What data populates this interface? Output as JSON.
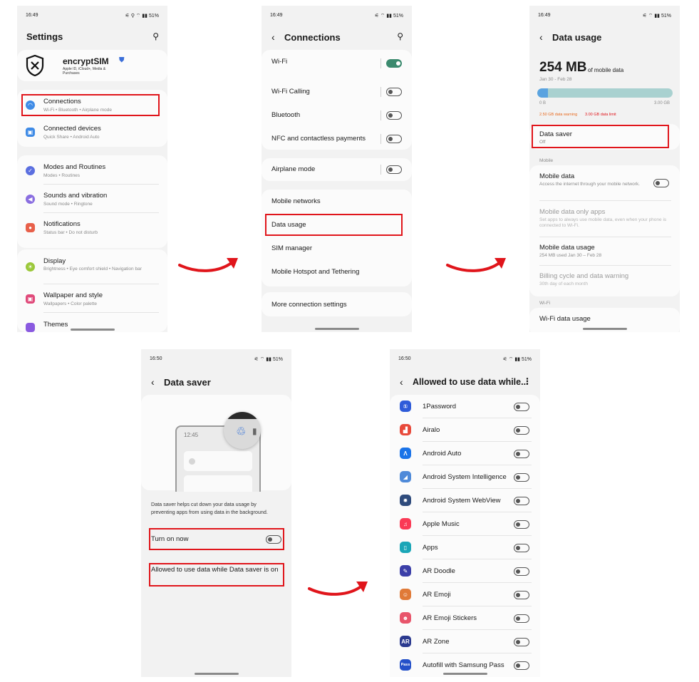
{
  "status": {
    "time_1": "16:49",
    "time_2": "16:49",
    "time_3": "16:49",
    "time_4": "16:50",
    "time_5": "16:50",
    "icons": "51%"
  },
  "settings": {
    "title": "Settings",
    "account_name": "encryptSIM",
    "account_sub": "Apple ID, iCloud+, Media & Purchases",
    "items": [
      {
        "label": "Connections",
        "sub": "Wi-Fi • Bluetooth • Airplane mode"
      },
      {
        "label": "Connected devices",
        "sub": "Quick Share • Android Auto"
      },
      {
        "label": "Modes and Routines",
        "sub": "Modes • Routines"
      },
      {
        "label": "Sounds and vibration",
        "sub": "Sound mode • Ringtone"
      },
      {
        "label": "Notifications",
        "sub": "Status bar • Do not disturb"
      },
      {
        "label": "Display",
        "sub": "Brightness • Eye comfort shield • Navigation bar"
      },
      {
        "label": "Wallpaper and style",
        "sub": "Wallpapers • Color palette"
      },
      {
        "label": "Themes",
        "sub": ""
      }
    ]
  },
  "connections": {
    "title": "Connections",
    "items": [
      {
        "label": "Wi-Fi"
      },
      {
        "label": "Wi-Fi Calling"
      },
      {
        "label": "Bluetooth"
      },
      {
        "label": "NFC and contactless payments"
      },
      {
        "label": "Airplane mode"
      },
      {
        "label": "Mobile networks"
      },
      {
        "label": "Data usage"
      },
      {
        "label": "SIM manager"
      },
      {
        "label": "Mobile Hotspot and Tethering"
      },
      {
        "label": "More connection settings"
      }
    ]
  },
  "data_usage": {
    "title": "Data usage",
    "amount": "254 MB",
    "amount_suffix": "of mobile data",
    "period": "Jan 30 - Feb 28",
    "usage_fraction": 0.08,
    "scale_min": "0 B",
    "scale_max": "3.00 GB",
    "warning_text": "2.50 GB data warning",
    "limit_text": "3.00 GB data limit",
    "data_saver_label": "Data saver",
    "data_saver_sub": "Off",
    "section_mobile": "Mobile",
    "mobile_data_label": "Mobile data",
    "mobile_data_sub": "Access the internet through your mobile network.",
    "mobile_only_label": "Mobile data only apps",
    "mobile_only_sub": "Set apps to always use mobile data, even when your phone is connected to Wi-Fi.",
    "mobile_usage_label": "Mobile data usage",
    "mobile_usage_sub": "254 MB used Jan 30 – Feb 28",
    "billing_label": "Billing cycle and data warning",
    "billing_sub": "30th day of each month",
    "section_wifi": "Wi-Fi",
    "wifi_usage_label": "Wi-Fi data usage"
  },
  "data_saver": {
    "title": "Data saver",
    "illus_time": "12:45",
    "description": "Data saver helps cut down your data usage by preventing apps from using data in the background.",
    "turn_on_label": "Turn on now",
    "allowed_label": "Allowed to use data while Data saver is on"
  },
  "allowed": {
    "title": "Allowed to use data while...",
    "apps": [
      {
        "name": "1Password",
        "icon": "1password-icon",
        "glyph": "①",
        "color": "#2e5bd9"
      },
      {
        "name": "Airalo",
        "icon": "airalo-icon",
        "glyph": "▟",
        "color": "#e84a3b"
      },
      {
        "name": "Android Auto",
        "icon": "android-auto-icon",
        "glyph": "Λ",
        "color": "#1a73e8"
      },
      {
        "name": "Android System Intelligence",
        "icon": "asi-icon",
        "glyph": "◢",
        "color": "#4f8ad9"
      },
      {
        "name": "Android System WebView",
        "icon": "webview-icon",
        "glyph": "✹",
        "color": "#2f4b7c"
      },
      {
        "name": "Apple Music",
        "icon": "apple-music-icon",
        "glyph": "♫",
        "color": "#fa3a55"
      },
      {
        "name": "Apps",
        "icon": "apps-icon",
        "glyph": "▯",
        "color": "#1aa6b7"
      },
      {
        "name": "AR Doodle",
        "icon": "ar-doodle-icon",
        "glyph": "✎",
        "color": "#3b3fa8"
      },
      {
        "name": "AR Emoji",
        "icon": "ar-emoji-icon",
        "glyph": "☺",
        "color": "#e07a38"
      },
      {
        "name": "AR Emoji Stickers",
        "icon": "ar-emoji-stickers-icon",
        "glyph": "☻",
        "color": "#e8556b"
      },
      {
        "name": "AR Zone",
        "icon": "ar-zone-icon",
        "glyph": "AR",
        "color": "#2b3a8f"
      },
      {
        "name": "Autofill with Samsung Pass",
        "icon": "samsung-pass-icon",
        "glyph": "Pass",
        "color": "#2451c9"
      }
    ]
  },
  "colors": {
    "highlight": "#e0151b",
    "arrow": "#e0151b",
    "toggle_on": "#3b8a6e",
    "usage_bar": "#5aa3e0",
    "usage_track": "#a9d1d0"
  }
}
